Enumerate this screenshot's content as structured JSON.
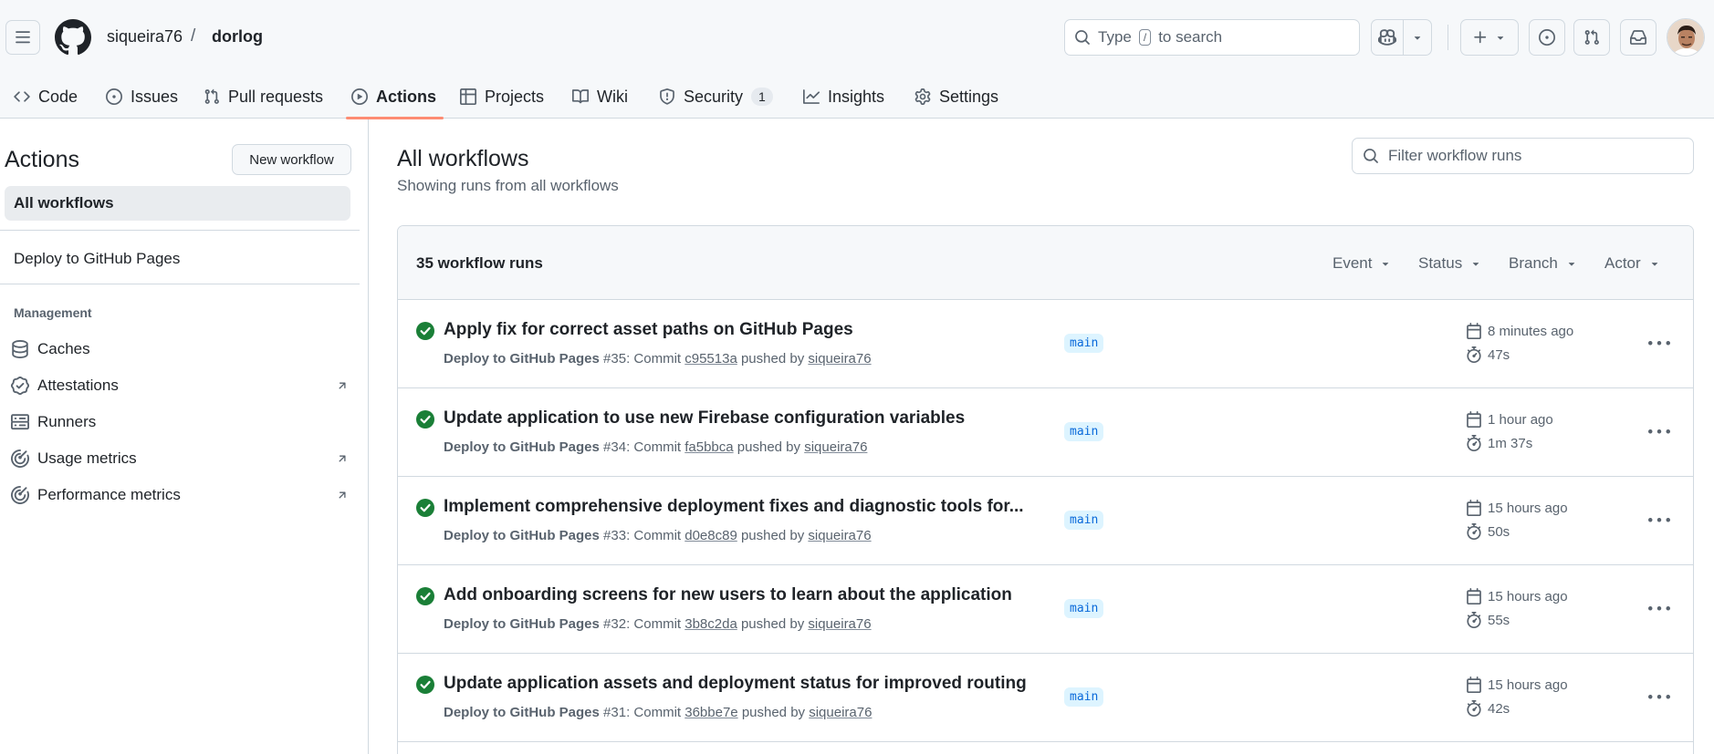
{
  "header": {
    "owner": "siqueira76",
    "separator": "/",
    "repo": "dorlog",
    "search": {
      "prefix": "Type",
      "key": "/",
      "suffix": "to search"
    }
  },
  "tabs": [
    {
      "label": "Code",
      "icon": "code-icon"
    },
    {
      "label": "Issues",
      "icon": "issue-icon"
    },
    {
      "label": "Pull requests",
      "icon": "pull-request-icon"
    },
    {
      "label": "Actions",
      "icon": "play-icon",
      "active": true
    },
    {
      "label": "Projects",
      "icon": "table-icon"
    },
    {
      "label": "Wiki",
      "icon": "book-icon"
    },
    {
      "label": "Security",
      "icon": "shield-icon",
      "count": "1"
    },
    {
      "label": "Insights",
      "icon": "graph-icon"
    },
    {
      "label": "Settings",
      "icon": "gear-icon"
    }
  ],
  "sidebar": {
    "title": "Actions",
    "new_workflow": "New workflow",
    "all_workflows": "All workflows",
    "workflows": [
      "Deploy to GitHub Pages"
    ],
    "management_heading": "Management",
    "management": [
      {
        "label": "Caches",
        "icon": "database-icon",
        "external": false
      },
      {
        "label": "Attestations",
        "icon": "verified-icon",
        "external": true
      },
      {
        "label": "Runners",
        "icon": "server-icon",
        "external": false
      },
      {
        "label": "Usage metrics",
        "icon": "meter-icon",
        "external": true
      },
      {
        "label": "Performance metrics",
        "icon": "meter-icon",
        "external": true
      }
    ]
  },
  "main": {
    "title": "All workflows",
    "subtitle": "Showing runs from all workflows",
    "filter_placeholder": "Filter workflow runs",
    "runs_count": "35 workflow runs",
    "filters": [
      "Event",
      "Status",
      "Branch",
      "Actor"
    ],
    "runs": [
      {
        "title": "Apply fix for correct asset paths on GitHub Pages",
        "workflow": "Deploy to GitHub Pages",
        "number": "#35",
        "commit_label": ": Commit",
        "commit": "c95513a",
        "pushed_by": "pushed by",
        "actor": "siqueira76",
        "branch": "main",
        "when": "8 minutes ago",
        "duration": "47s"
      },
      {
        "title": "Update application to use new Firebase configuration variables",
        "workflow": "Deploy to GitHub Pages",
        "number": "#34",
        "commit_label": ": Commit",
        "commit": "fa5bbca",
        "pushed_by": "pushed by",
        "actor": "siqueira76",
        "branch": "main",
        "when": "1 hour ago",
        "duration": "1m 37s"
      },
      {
        "title": "Implement comprehensive deployment fixes and diagnostic tools for...",
        "workflow": "Deploy to GitHub Pages",
        "number": "#33",
        "commit_label": ": Commit",
        "commit": "d0e8c89",
        "pushed_by": "pushed by",
        "actor": "siqueira76",
        "branch": "main",
        "when": "15 hours ago",
        "duration": "50s"
      },
      {
        "title": "Add onboarding screens for new users to learn about the application",
        "workflow": "Deploy to GitHub Pages",
        "number": "#32",
        "commit_label": ": Commit",
        "commit": "3b8c2da",
        "pushed_by": "pushed by",
        "actor": "siqueira76",
        "branch": "main",
        "when": "15 hours ago",
        "duration": "55s"
      },
      {
        "title": "Update application assets and deployment status for improved routing",
        "workflow": "Deploy to GitHub Pages",
        "number": "#31",
        "commit_label": ": Commit",
        "commit": "36bbe7e",
        "pushed_by": "pushed by",
        "actor": "siqueira76",
        "branch": "main",
        "when": "15 hours ago",
        "duration": "42s"
      }
    ]
  },
  "colors": {
    "success": "#1a7f37",
    "accent_underline": "#fd8c73",
    "branch_bg": "#ddf4ff",
    "branch_fg": "#0969da"
  }
}
